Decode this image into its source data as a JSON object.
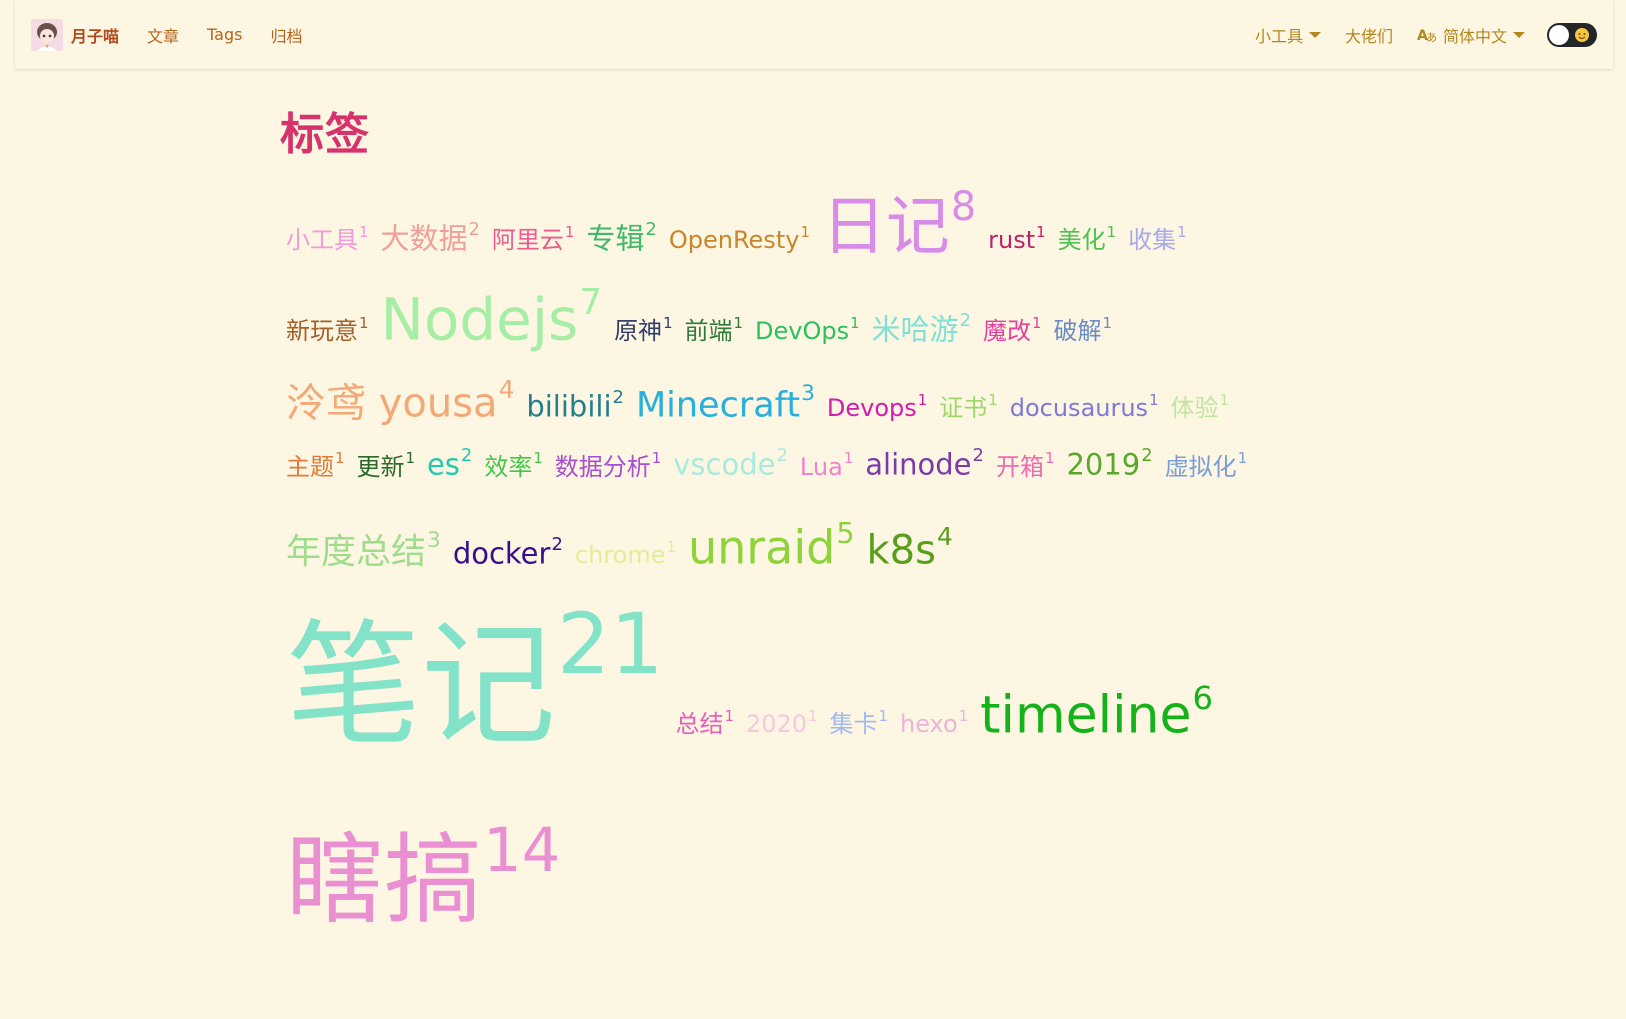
{
  "navbar": {
    "brand": "月子喵",
    "links": [
      "文章",
      "Tags",
      "归档"
    ],
    "tools_label": "小工具",
    "friends_label": "大佬们",
    "language_label": "简体中文"
  },
  "page": {
    "title": "标签"
  },
  "tag_rows": [
    [
      {
        "name": "小工具",
        "count": "1",
        "color": "#f19bd6",
        "size": 24
      },
      {
        "name": "大数据",
        "count": "2",
        "color": "#f0a09a",
        "size": 29
      },
      {
        "name": "阿里云",
        "count": "1",
        "color": "#ec5c8e",
        "size": 24
      },
      {
        "name": "专辑",
        "count": "2",
        "color": "#3fb96b",
        "size": 29
      },
      {
        "name": "OpenResty",
        "count": "1",
        "color": "#c8862a",
        "size": 24
      },
      {
        "name": "日记",
        "count": "8",
        "color": "#d98be8",
        "size": 64
      },
      {
        "name": "rust",
        "count": "1",
        "color": "#c0206a",
        "size": 24
      },
      {
        "name": "美化",
        "count": "1",
        "color": "#4ec24e",
        "size": 24
      },
      {
        "name": "收集",
        "count": "1",
        "color": "#a9a9ec",
        "size": 24
      }
    ],
    [
      {
        "name": "新玩意",
        "count": "1",
        "color": "#a5602a",
        "size": 24
      },
      {
        "name": "Nodejs",
        "count": "7",
        "color": "#a6eea6",
        "size": 58
      },
      {
        "name": "原神",
        "count": "1",
        "color": "#343e6b",
        "size": 24
      },
      {
        "name": "前端",
        "count": "1",
        "color": "#2f7a3a",
        "size": 24
      },
      {
        "name": "DevOps",
        "count": "1",
        "color": "#29c25b",
        "size": 24
      },
      {
        "name": "米哈游",
        "count": "2",
        "color": "#7fe0d4",
        "size": 29
      },
      {
        "name": "魔改",
        "count": "1",
        "color": "#e83f9f",
        "size": 24
      },
      {
        "name": "破解",
        "count": "1",
        "color": "#6a8cc4",
        "size": 24
      }
    ],
    [
      {
        "name": "泠鸢 yousa",
        "count": "4",
        "color": "#f2a977",
        "size": 40
      },
      {
        "name": "bilibili",
        "count": "2",
        "color": "#237f8c",
        "size": 29
      },
      {
        "name": "Minecraft",
        "count": "3",
        "color": "#27b0d9",
        "size": 35
      },
      {
        "name": "Devops",
        "count": "1",
        "color": "#d61aac",
        "size": 24
      },
      {
        "name": "证书",
        "count": "1",
        "color": "#9ed86a",
        "size": 24
      },
      {
        "name": "docusaurus",
        "count": "1",
        "color": "#7e79d6",
        "size": 24
      },
      {
        "name": "体验",
        "count": "1",
        "color": "#bfe6a0",
        "size": 24
      }
    ],
    [
      {
        "name": "主题",
        "count": "1",
        "color": "#e07a3a",
        "size": 24
      },
      {
        "name": "更新",
        "count": "1",
        "color": "#2a6b2a",
        "size": 24
      },
      {
        "name": "es",
        "count": "2",
        "color": "#22c9b1",
        "size": 29
      },
      {
        "name": "效率",
        "count": "1",
        "color": "#41c84a",
        "size": 24
      },
      {
        "name": "数据分析",
        "count": "1",
        "color": "#a94fd1",
        "size": 24
      },
      {
        "name": "vscode",
        "count": "2",
        "color": "#a8ebdd",
        "size": 29
      },
      {
        "name": "Lua",
        "count": "1",
        "color": "#f083c9",
        "size": 24
      },
      {
        "name": "alinode",
        "count": "2",
        "color": "#7a3aa8",
        "size": 29
      },
      {
        "name": "开箱",
        "count": "1",
        "color": "#f06ab0",
        "size": 24
      },
      {
        "name": "2019",
        "count": "2",
        "color": "#5aa82a",
        "size": 29
      },
      {
        "name": "虚拟化",
        "count": "1",
        "color": "#7a9cd9",
        "size": 24
      }
    ],
    [
      {
        "name": "年度总结",
        "count": "3",
        "color": "#9fdc8c",
        "size": 35
      },
      {
        "name": "docker",
        "count": "2",
        "color": "#3a0e8a",
        "size": 29
      },
      {
        "name": "chrome",
        "count": "1",
        "color": "#e0ee9a",
        "size": 24
      },
      {
        "name": "unraid",
        "count": "5",
        "color": "#8fd33a",
        "size": 46
      },
      {
        "name": "k8s",
        "count": "4",
        "color": "#5a9f1c",
        "size": 40
      }
    ],
    [
      {
        "name": "笔记",
        "count": "21",
        "color": "#82e3c9",
        "size": 135
      },
      {
        "name": "总结",
        "count": "1",
        "color": "#e85fb8",
        "size": 24
      },
      {
        "name": "2020",
        "count": "1",
        "color": "#f6c8dd",
        "size": 24
      },
      {
        "name": "集卡",
        "count": "1",
        "color": "#a5b9ee",
        "size": 24
      },
      {
        "name": "hexo",
        "count": "1",
        "color": "#edb4d8",
        "size": 24
      },
      {
        "name": "timeline",
        "count": "6",
        "color": "#14b31a",
        "size": 52
      }
    ],
    [
      {
        "name": "瞎搞",
        "count": "14",
        "color": "#ea8fd2",
        "size": 98
      }
    ]
  ]
}
